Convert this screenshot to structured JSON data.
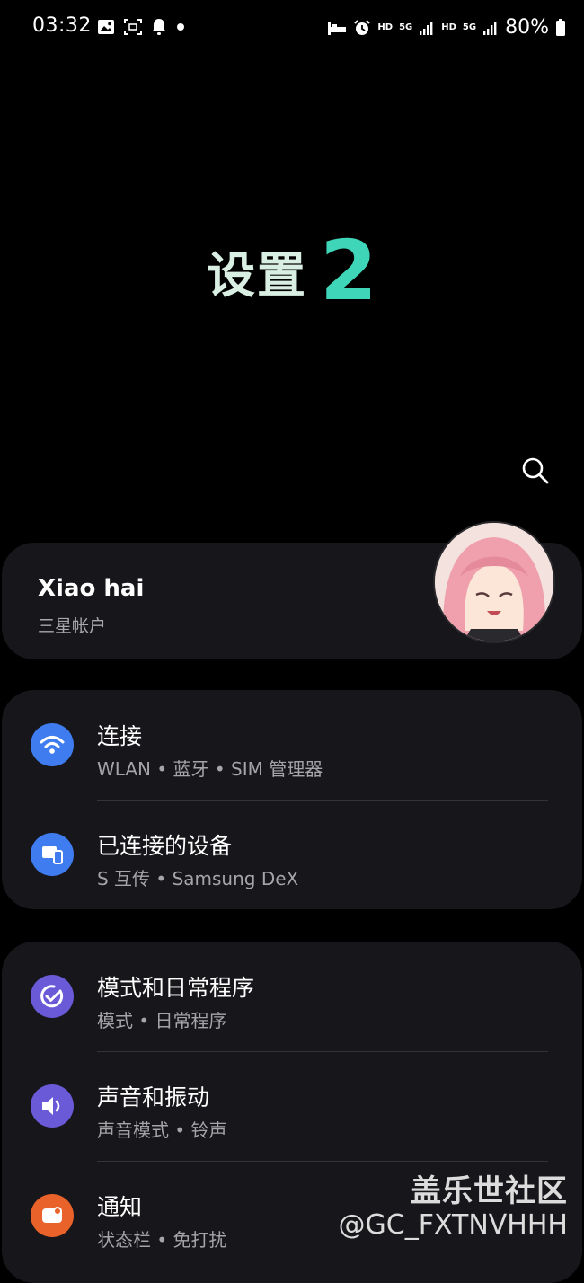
{
  "status_bar": {
    "time": "03:32",
    "left_icons": [
      "gallery-icon",
      "screenshot-icon",
      "bell-icon",
      "dot-icon"
    ],
    "right_icons": [
      "sleep-icon",
      "alarm-icon",
      "hd-icon",
      "5g-icon",
      "signal-icon",
      "hd-icon",
      "5g-signal-icon",
      "battery-icon"
    ],
    "hd1": "HD",
    "net1": "5G",
    "hd2": "HD",
    "net2": "5G",
    "battery": "80%"
  },
  "header": {
    "title": "设置",
    "title_number": "2"
  },
  "account": {
    "name": "Xiao hai",
    "subtitle": "三星帐户"
  },
  "group1": [
    {
      "title": "连接",
      "subtitle": "WLAN  •  蓝牙  •  SIM 管理器",
      "icon": "wifi-icon",
      "color": "#3f7cf0"
    },
    {
      "title": "已连接的设备",
      "subtitle": "S 互传  •  Samsung DeX",
      "icon": "devices-icon",
      "color": "#3f7cf0"
    }
  ],
  "group2": [
    {
      "title": "模式和日常程序",
      "subtitle": "模式  •  日常程序",
      "icon": "modes-icon",
      "color": "#6a5ad8"
    },
    {
      "title": "声音和振动",
      "subtitle": "声音模式  •  铃声",
      "icon": "speaker-icon",
      "color": "#6a5ad8"
    },
    {
      "title": "通知",
      "subtitle": "状态栏  •  免打扰",
      "icon": "notification-icon",
      "color": "#e8622a"
    }
  ],
  "watermark": {
    "line1": "盖乐世社区",
    "line2": "@GC_FXTNVHHH"
  },
  "colors": {
    "background": "#000000",
    "card": "#17171b",
    "accent_title": "#3fd5b8",
    "blue_icon": "#3f7cf0",
    "purple_icon": "#6a5ad8",
    "orange_icon": "#e8622a"
  }
}
